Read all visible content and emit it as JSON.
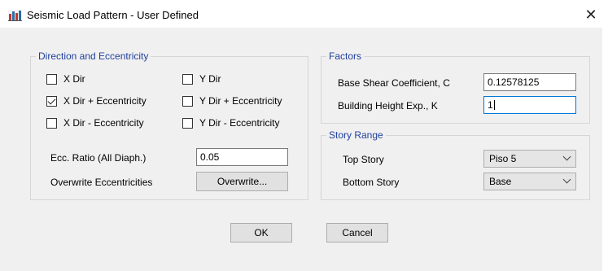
{
  "window": {
    "title": "Seismic Load Pattern - User Defined",
    "close_glyph": "✕",
    "icon": "app-grid-icon"
  },
  "direction": {
    "group_title": "Direction and Eccentricity",
    "checks": [
      {
        "label": "X Dir",
        "checked": false
      },
      {
        "label": "Y Dir",
        "checked": false
      },
      {
        "label": "X Dir + Eccentricity",
        "checked": true
      },
      {
        "label": "Y Dir + Eccentricity",
        "checked": false
      },
      {
        "label": "X Dir - Eccentricity",
        "checked": false
      },
      {
        "label": "Y Dir - Eccentricity",
        "checked": false
      }
    ],
    "ecc_ratio_label": "Ecc. Ratio (All Diaph.)",
    "ecc_ratio_value": "0.05",
    "overwrite_label": "Overwrite Eccentricities",
    "overwrite_button": "Overwrite..."
  },
  "factors": {
    "group_title": "Factors",
    "base_shear_label": "Base Shear Coefficient, C",
    "base_shear_value": "0.12578125",
    "height_exp_label": "Building Height Exp., K",
    "height_exp_value": "1"
  },
  "story_range": {
    "group_title": "Story Range",
    "top_label": "Top Story",
    "top_value": "Piso 5",
    "bottom_label": "Bottom Story",
    "bottom_value": "Base"
  },
  "buttons": {
    "ok": "OK",
    "cancel": "Cancel"
  },
  "colors": {
    "group_title": "#1f3f9c",
    "focus_border": "#0078d7",
    "dialog_bg": "#f0f0f0"
  }
}
